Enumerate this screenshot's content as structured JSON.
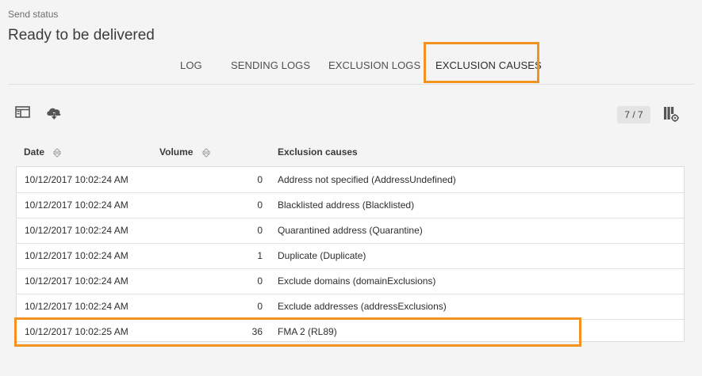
{
  "header": {
    "status_label": "Send status",
    "status_value": "Ready to be delivered"
  },
  "tabs": [
    {
      "label": "LOG",
      "active": false
    },
    {
      "label": "SENDING LOGS",
      "active": false
    },
    {
      "label": "EXCLUSION LOGS",
      "active": false
    },
    {
      "label": "EXCLUSION CAUSES",
      "active": true
    }
  ],
  "toolbar": {
    "icons": [
      "panel-toggle-icon",
      "cloud-download-icon",
      "column-settings-icon"
    ],
    "pager": "7 / 7"
  },
  "table": {
    "columns": [
      "Date",
      "Volume",
      "Exclusion causes"
    ],
    "rows": [
      {
        "date": "10/12/2017 10:02:24 AM",
        "volume": "0",
        "cause": "Address not specified (AddressUndefined)"
      },
      {
        "date": "10/12/2017 10:02:24 AM",
        "volume": "0",
        "cause": "Blacklisted address (Blacklisted)"
      },
      {
        "date": "10/12/2017 10:02:24 AM",
        "volume": "0",
        "cause": "Quarantined address (Quarantine)"
      },
      {
        "date": "10/12/2017 10:02:24 AM",
        "volume": "1",
        "cause": "Duplicate (Duplicate)"
      },
      {
        "date": "10/12/2017 10:02:24 AM",
        "volume": "0",
        "cause": "Exclude domains (domainExclusions)"
      },
      {
        "date": "10/12/2017 10:02:24 AM",
        "volume": "0",
        "cause": "Exclude addresses (addressExclusions)"
      },
      {
        "date": "10/12/2017 10:02:25 AM",
        "volume": "36",
        "cause": "FMA 2 (RL89)"
      }
    ]
  },
  "colors": {
    "highlight": "#f3931f",
    "background": "#f4f4f4"
  }
}
